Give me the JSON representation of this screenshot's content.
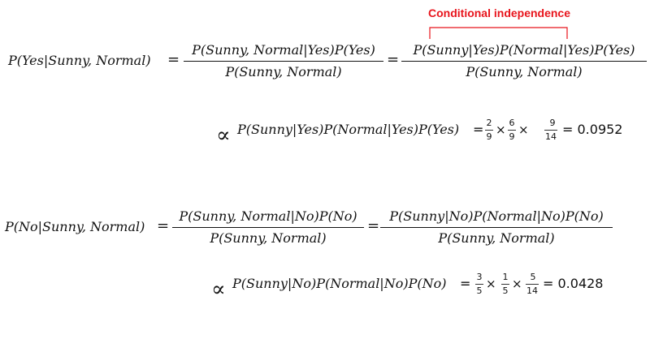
{
  "annotation": {
    "label": "Conditional independence",
    "color": "#e8141c"
  },
  "yes": {
    "lhs": "P(Yes|Sunny, Normal)",
    "eq1": "=",
    "frac1_num": "P(Sunny, Normal|Yes)P(Yes)",
    "frac1_den": "P(Sunny, Normal)",
    "eq2": "=",
    "frac2_num": "P(Sunny|Yes)P(Normal|Yes)P(Yes)",
    "frac2_den": "P(Sunny, Normal)",
    "prop": "∝",
    "expr": "P(Sunny|Yes)P(Normal|Yes)P(Yes)",
    "eq3": "=",
    "f1_num": "2",
    "f1_den": "9",
    "times1": "×",
    "f2_num": "6",
    "f2_den": "9",
    "times2": "×",
    "f3_num": "9",
    "f3_den": "14",
    "result": "= 0.0952"
  },
  "no": {
    "lhs": "P(No|Sunny, Normal)",
    "eq1": "=",
    "frac1_num": "P(Sunny, Normal|No)P(No)",
    "frac1_den": "P(Sunny, Normal)",
    "eq2": "=",
    "frac2_num": "P(Sunny|No)P(Normal|No)P(No)",
    "frac2_den": "P(Sunny, Normal)",
    "prop": "∝",
    "expr": "P(Sunny|No)P(Normal|No)P(No)",
    "eq3": "=",
    "f1_num": "3",
    "f1_den": "5",
    "times1": "×",
    "f2_num": "1",
    "f2_den": "5",
    "times2": "×",
    "f3_num": "5",
    "f3_den": "14",
    "result": "= 0.0428"
  }
}
